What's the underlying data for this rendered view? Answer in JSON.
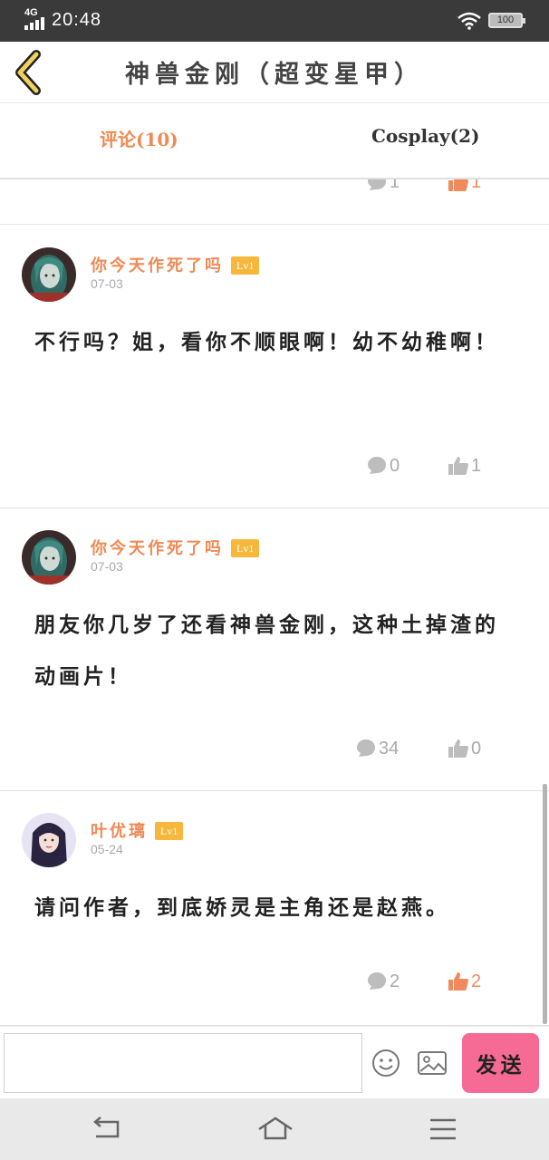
{
  "status_bar": {
    "network": "4G",
    "time": "20:48",
    "battery": "100"
  },
  "header": {
    "title": "神兽金刚（超变星甲）"
  },
  "tabs": [
    {
      "label": "评论(10)",
      "active": true
    },
    {
      "label": "Cosplay(2)",
      "active": false
    }
  ],
  "partial_row": {
    "reply_count": "1",
    "like_count": "1"
  },
  "comments": [
    {
      "username": "你今天作死了吗",
      "level": "Lv1",
      "date": "07-03",
      "text": "不行吗？姐，看你不顺眼啊！幼不幼稚啊！",
      "reply_count": "0",
      "like_count": "1",
      "liked": false
    },
    {
      "username": "你今天作死了吗",
      "level": "Lv1",
      "date": "07-03",
      "text": "朋友你几岁了还看神兽金刚，这种土掉渣的动画片！",
      "reply_count": "34",
      "like_count": "0",
      "liked": false
    },
    {
      "username": "叶优璃",
      "level": "Lv1",
      "date": "05-24",
      "text": "请问作者，到底娇灵是主角还是赵燕。",
      "reply_count": "2",
      "like_count": "2",
      "liked": true
    }
  ],
  "input": {
    "placeholder": "",
    "send_label": "发送"
  },
  "colors": {
    "accent": "#ef8a54",
    "send": "#f56b95",
    "level_badge": "#f6b73c",
    "like_active": "#f08a5c"
  },
  "icons": [
    "back-chevron-icon",
    "comment-bubble-icon",
    "thumbs-up-icon",
    "emoji-icon",
    "image-icon",
    "nav-back-icon",
    "nav-home-icon",
    "nav-menu-icon"
  ]
}
